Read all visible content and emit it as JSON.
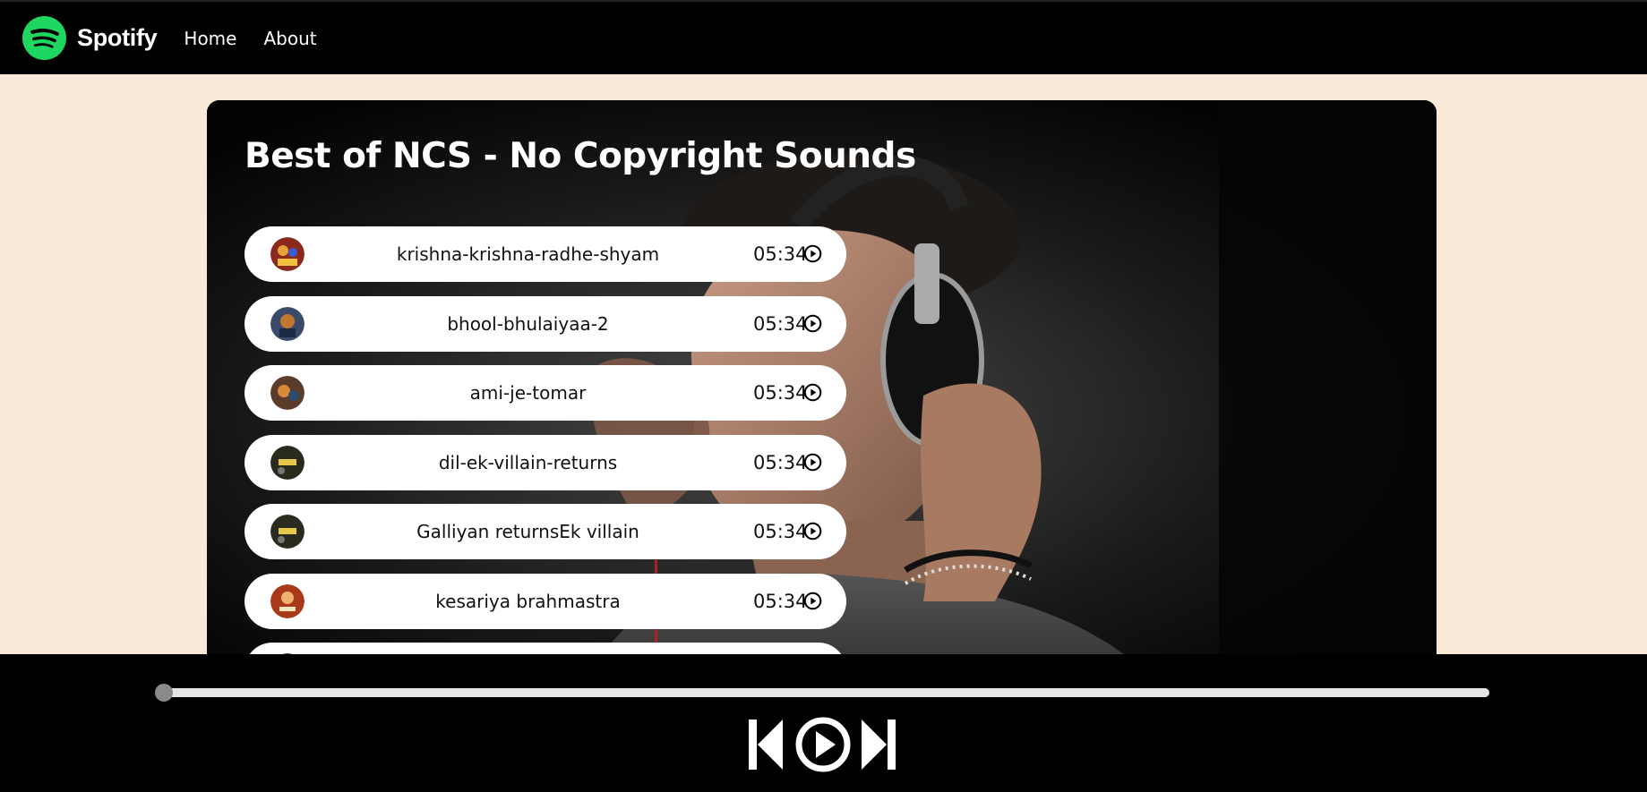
{
  "nav": {
    "brand": "Spotify",
    "links": [
      "Home",
      "About"
    ]
  },
  "playlist": {
    "title": "Best of NCS - No Copyright Sounds",
    "songs": [
      {
        "name": "krishna-krishna-radhe-shyam",
        "duration": "05:34",
        "cover_color": "#8b2a1c"
      },
      {
        "name": "bhool-bhulaiyaa-2",
        "duration": "05:34",
        "cover_color": "#3a4a6b"
      },
      {
        "name": "ami-je-tomar",
        "duration": "05:34",
        "cover_color": "#5b3b2a"
      },
      {
        "name": "dil-ek-villain-returns",
        "duration": "05:34",
        "cover_color": "#2b2a1e"
      },
      {
        "name": "Galliyan returnsEk villain",
        "duration": "05:34",
        "cover_color": "#2b2a1e"
      },
      {
        "name": "kesariya brahmastra",
        "duration": "05:34",
        "cover_color": "#a83a1a"
      }
    ]
  },
  "player": {
    "progress": 0
  },
  "icons": [
    "spotify-logo",
    "play-circle-icon",
    "previous-icon",
    "play-icon",
    "next-icon"
  ],
  "colors": {
    "page_bg": "#f9e9d6",
    "nav_bg": "#000000",
    "brand_green": "#1ed760",
    "song_bg": "#ffffff"
  }
}
